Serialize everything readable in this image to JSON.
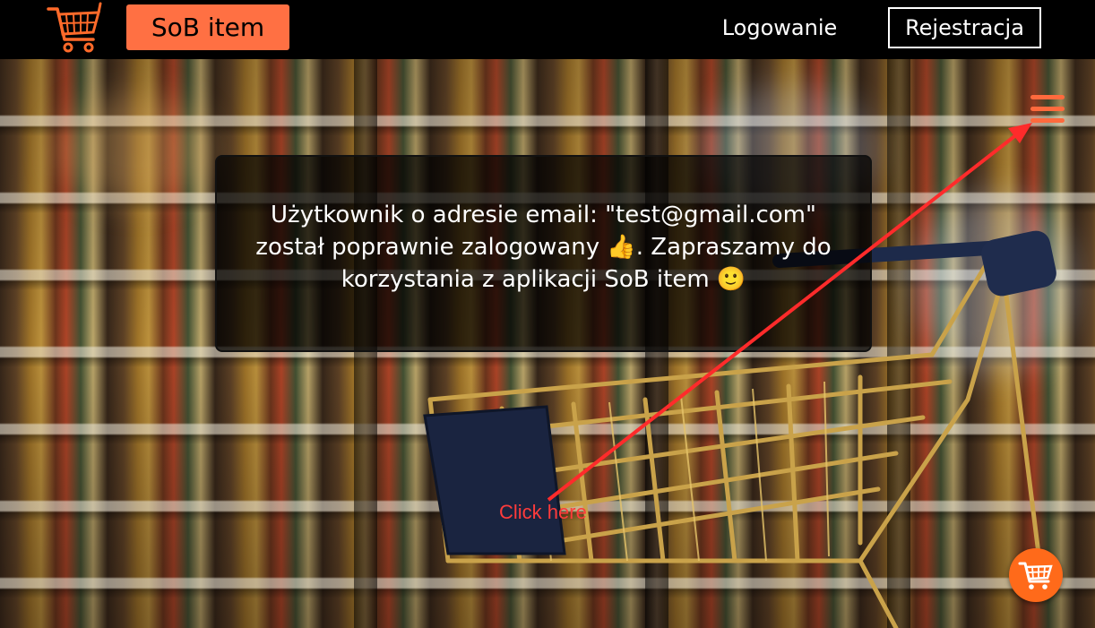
{
  "navbar": {
    "logo_icon": "shopping-cart-icon",
    "brand_label": "SoB item",
    "login_label": "Logowanie",
    "register_label": "Rejestracja"
  },
  "menu": {
    "icon": "hamburger-menu-icon"
  },
  "message": {
    "text": "Użytkownik o adresie email: \"test@gmail.com\" został poprawnie zalogowany 👍. Zapraszamy do korzystania z aplikacji SoB item 🙂"
  },
  "annotation": {
    "label": "Click here"
  },
  "fab": {
    "icon": "shopping-cart-icon"
  },
  "colors": {
    "accent": "#ff7043",
    "navbar_bg": "#000000",
    "annotation": "#ff3b3b"
  }
}
